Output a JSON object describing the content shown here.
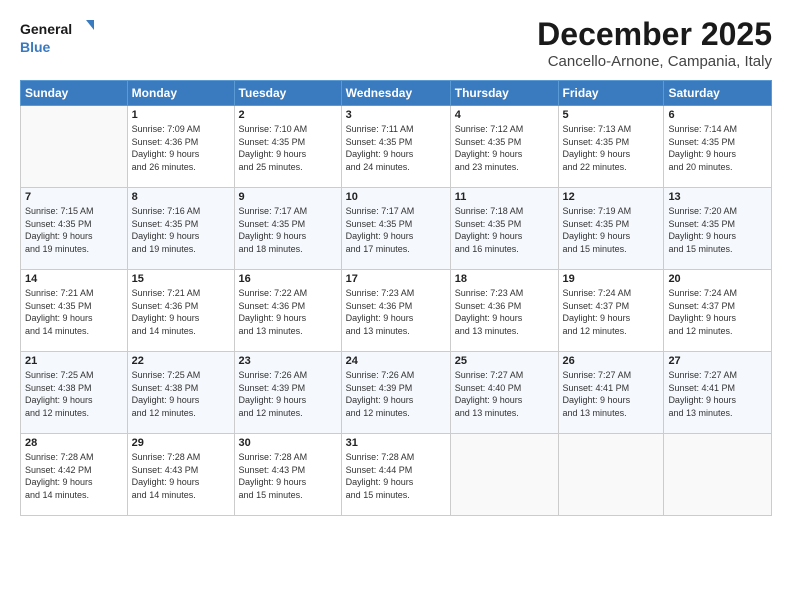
{
  "logo": {
    "line1": "General",
    "line2": "Blue"
  },
  "header": {
    "title": "December 2025",
    "location": "Cancello-Arnone, Campania, Italy"
  },
  "weekdays": [
    "Sunday",
    "Monday",
    "Tuesday",
    "Wednesday",
    "Thursday",
    "Friday",
    "Saturday"
  ],
  "weeks": [
    [
      {
        "day": "",
        "info": ""
      },
      {
        "day": "1",
        "info": "Sunrise: 7:09 AM\nSunset: 4:36 PM\nDaylight: 9 hours\nand 26 minutes."
      },
      {
        "day": "2",
        "info": "Sunrise: 7:10 AM\nSunset: 4:35 PM\nDaylight: 9 hours\nand 25 minutes."
      },
      {
        "day": "3",
        "info": "Sunrise: 7:11 AM\nSunset: 4:35 PM\nDaylight: 9 hours\nand 24 minutes."
      },
      {
        "day": "4",
        "info": "Sunrise: 7:12 AM\nSunset: 4:35 PM\nDaylight: 9 hours\nand 23 minutes."
      },
      {
        "day": "5",
        "info": "Sunrise: 7:13 AM\nSunset: 4:35 PM\nDaylight: 9 hours\nand 22 minutes."
      },
      {
        "day": "6",
        "info": "Sunrise: 7:14 AM\nSunset: 4:35 PM\nDaylight: 9 hours\nand 20 minutes."
      }
    ],
    [
      {
        "day": "7",
        "info": "Sunrise: 7:15 AM\nSunset: 4:35 PM\nDaylight: 9 hours\nand 19 minutes."
      },
      {
        "day": "8",
        "info": "Sunrise: 7:16 AM\nSunset: 4:35 PM\nDaylight: 9 hours\nand 19 minutes."
      },
      {
        "day": "9",
        "info": "Sunrise: 7:17 AM\nSunset: 4:35 PM\nDaylight: 9 hours\nand 18 minutes."
      },
      {
        "day": "10",
        "info": "Sunrise: 7:17 AM\nSunset: 4:35 PM\nDaylight: 9 hours\nand 17 minutes."
      },
      {
        "day": "11",
        "info": "Sunrise: 7:18 AM\nSunset: 4:35 PM\nDaylight: 9 hours\nand 16 minutes."
      },
      {
        "day": "12",
        "info": "Sunrise: 7:19 AM\nSunset: 4:35 PM\nDaylight: 9 hours\nand 15 minutes."
      },
      {
        "day": "13",
        "info": "Sunrise: 7:20 AM\nSunset: 4:35 PM\nDaylight: 9 hours\nand 15 minutes."
      }
    ],
    [
      {
        "day": "14",
        "info": "Sunrise: 7:21 AM\nSunset: 4:35 PM\nDaylight: 9 hours\nand 14 minutes."
      },
      {
        "day": "15",
        "info": "Sunrise: 7:21 AM\nSunset: 4:36 PM\nDaylight: 9 hours\nand 14 minutes."
      },
      {
        "day": "16",
        "info": "Sunrise: 7:22 AM\nSunset: 4:36 PM\nDaylight: 9 hours\nand 13 minutes."
      },
      {
        "day": "17",
        "info": "Sunrise: 7:23 AM\nSunset: 4:36 PM\nDaylight: 9 hours\nand 13 minutes."
      },
      {
        "day": "18",
        "info": "Sunrise: 7:23 AM\nSunset: 4:36 PM\nDaylight: 9 hours\nand 13 minutes."
      },
      {
        "day": "19",
        "info": "Sunrise: 7:24 AM\nSunset: 4:37 PM\nDaylight: 9 hours\nand 12 minutes."
      },
      {
        "day": "20",
        "info": "Sunrise: 7:24 AM\nSunset: 4:37 PM\nDaylight: 9 hours\nand 12 minutes."
      }
    ],
    [
      {
        "day": "21",
        "info": "Sunrise: 7:25 AM\nSunset: 4:38 PM\nDaylight: 9 hours\nand 12 minutes."
      },
      {
        "day": "22",
        "info": "Sunrise: 7:25 AM\nSunset: 4:38 PM\nDaylight: 9 hours\nand 12 minutes."
      },
      {
        "day": "23",
        "info": "Sunrise: 7:26 AM\nSunset: 4:39 PM\nDaylight: 9 hours\nand 12 minutes."
      },
      {
        "day": "24",
        "info": "Sunrise: 7:26 AM\nSunset: 4:39 PM\nDaylight: 9 hours\nand 12 minutes."
      },
      {
        "day": "25",
        "info": "Sunrise: 7:27 AM\nSunset: 4:40 PM\nDaylight: 9 hours\nand 13 minutes."
      },
      {
        "day": "26",
        "info": "Sunrise: 7:27 AM\nSunset: 4:41 PM\nDaylight: 9 hours\nand 13 minutes."
      },
      {
        "day": "27",
        "info": "Sunrise: 7:27 AM\nSunset: 4:41 PM\nDaylight: 9 hours\nand 13 minutes."
      }
    ],
    [
      {
        "day": "28",
        "info": "Sunrise: 7:28 AM\nSunset: 4:42 PM\nDaylight: 9 hours\nand 14 minutes."
      },
      {
        "day": "29",
        "info": "Sunrise: 7:28 AM\nSunset: 4:43 PM\nDaylight: 9 hours\nand 14 minutes."
      },
      {
        "day": "30",
        "info": "Sunrise: 7:28 AM\nSunset: 4:43 PM\nDaylight: 9 hours\nand 15 minutes."
      },
      {
        "day": "31",
        "info": "Sunrise: 7:28 AM\nSunset: 4:44 PM\nDaylight: 9 hours\nand 15 minutes."
      },
      {
        "day": "",
        "info": ""
      },
      {
        "day": "",
        "info": ""
      },
      {
        "day": "",
        "info": ""
      }
    ]
  ]
}
